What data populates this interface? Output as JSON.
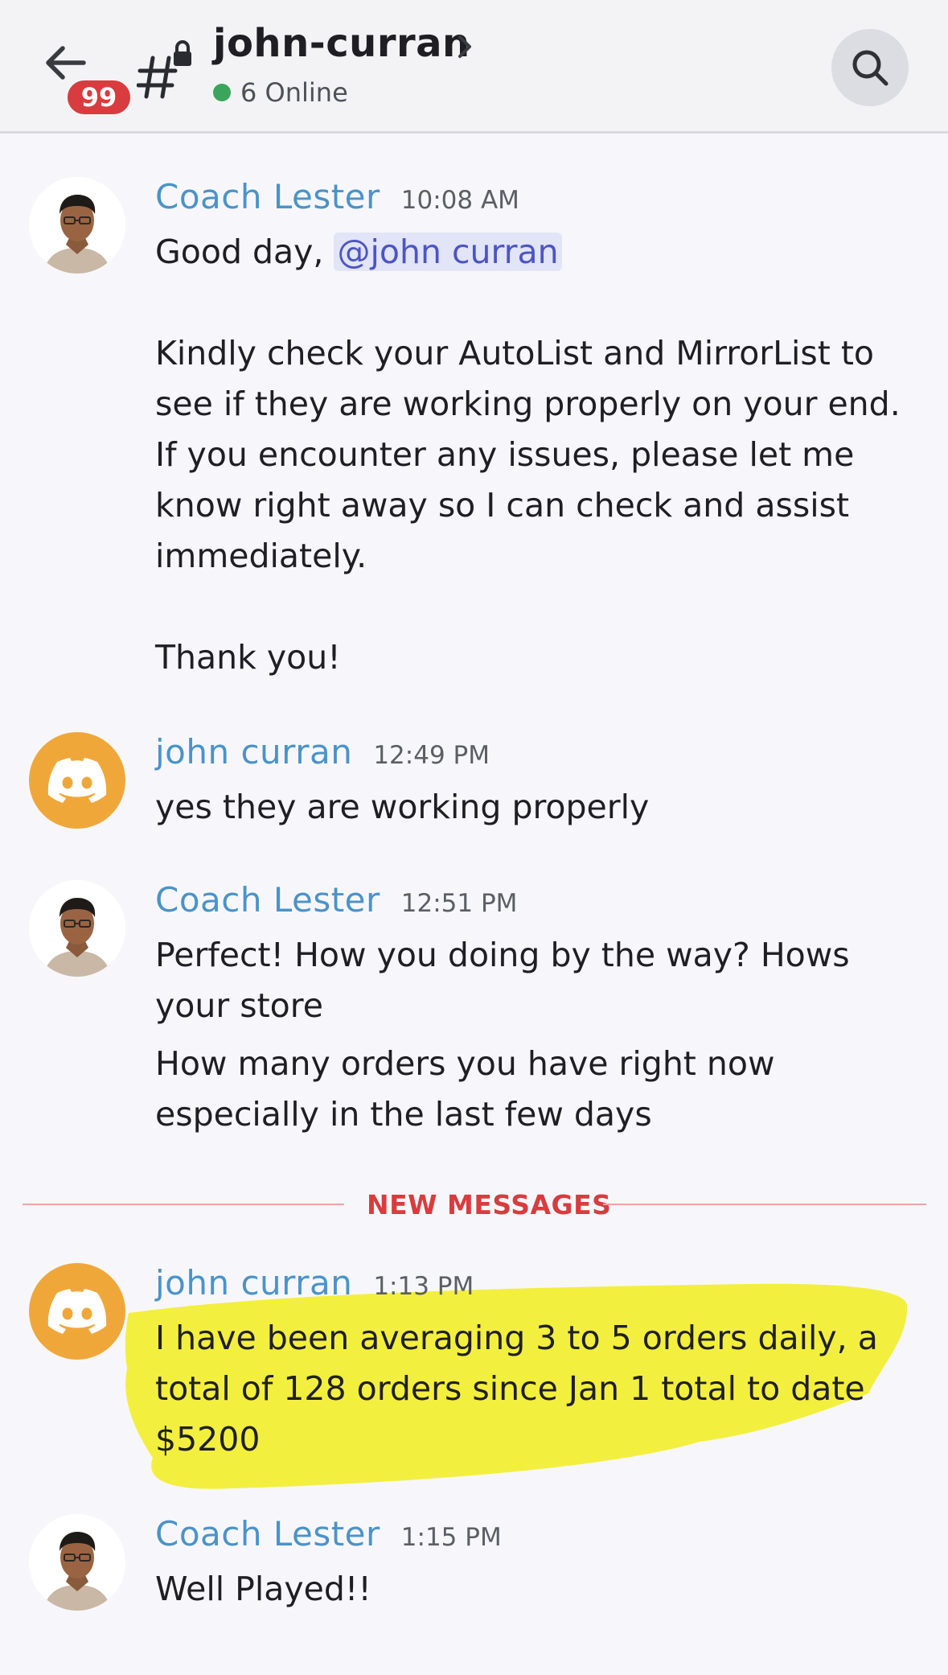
{
  "header": {
    "unread_badge": "99",
    "channel_name": "john-curran",
    "online_count": "6 Online",
    "icons": {
      "back": "back-arrow-icon",
      "channel": "locked-channel-icon",
      "chevron": "chevron-right-icon",
      "search": "search-icon"
    }
  },
  "messages": [
    {
      "author": "Coach Lester",
      "time": "10:08 AM",
      "avatar": "photo",
      "greeting": "Good day, ",
      "mention": "@john curran",
      "paragraph": "Kindly check your AutoList and MirrorList to see if they are working properly on your end. If you encounter any issues, please let me know right away so I can check and assist immediately.",
      "closing": "Thank you!"
    },
    {
      "author": "john curran",
      "time": "12:49 PM",
      "avatar": "discord",
      "text": "yes they are working properly"
    },
    {
      "author": "Coach Lester",
      "time": "12:51 PM",
      "avatar": "photo",
      "text": "Perfect! How you doing by the way? Hows your store",
      "text2": "How many orders you have right now especially in the last few days"
    },
    {
      "author": "john curran",
      "time": "1:13 PM",
      "avatar": "discord",
      "text": "I have been averaging 3 to 5 orders daily, a total of 128 orders since Jan 1 total to date $5200"
    },
    {
      "author": "Coach Lester",
      "time": "1:15 PM",
      "avatar": "photo",
      "text": "Well Played!!"
    }
  ],
  "divider_label": "NEW MESSAGES",
  "colors": {
    "author_name": "#4b93c9",
    "mention_text": "#4c55c3",
    "mention_bg": "#e2e4f7",
    "badge": "#d83c3e",
    "online": "#3ba55c",
    "discord_avatar": "#f0a73a",
    "highlight": "#f2ee2e"
  }
}
